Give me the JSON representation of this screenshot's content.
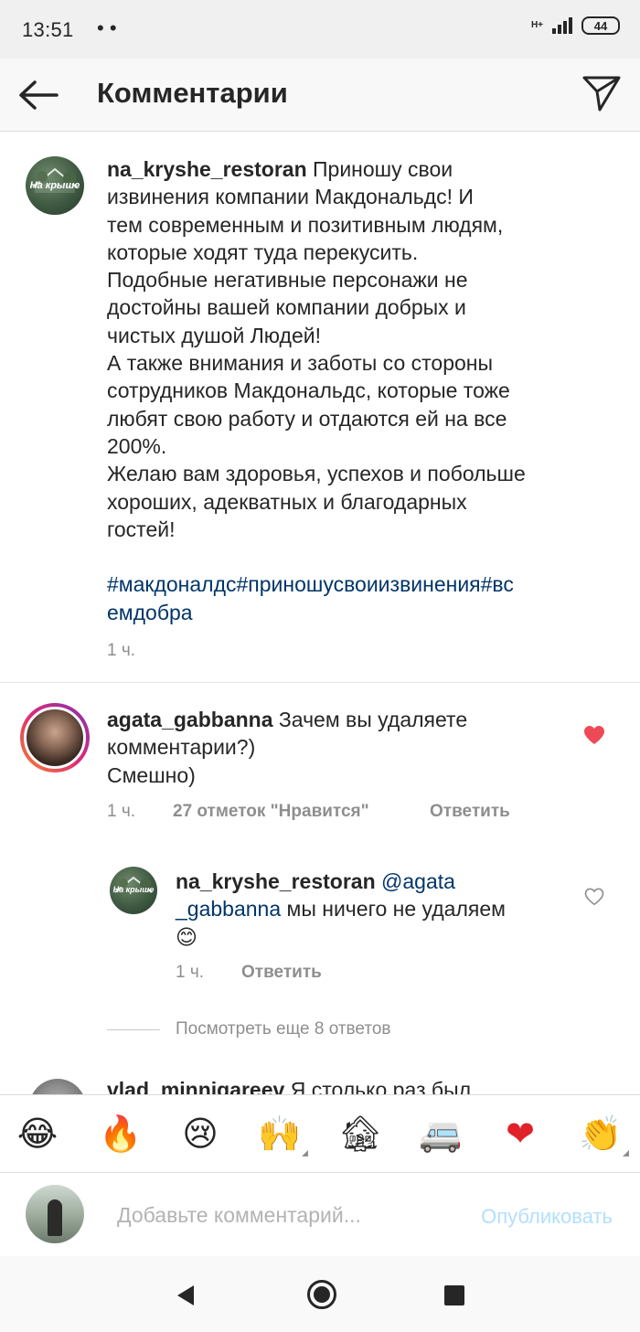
{
  "status": {
    "time": "13:51",
    "dots": "• •",
    "network": "H+",
    "battery": "44"
  },
  "header": {
    "title": "Комментарии"
  },
  "post": {
    "username": "na_kryshe_restoran",
    "text": " Приношу свои\nизвинения компании Макдональдс! И\nтем современным и позитивным людям,\nкоторые ходят туда перекусить.\nПодобные негативные персонажи не\nдостойны вашей компании добрых и\nчистых душой Людей!\nА также внимания и заботы со стороны\nсотрудников Макдональдс, которые тоже\nлюбят свою работу и отдаются ей на все\n200%.\nЖелаю вам здоровья, успехов и побольше\nхороших, адекватных и благодарных\nгостей!\n\n",
    "hashtags": "#макдоналдс#приношусвоиизвинения#вс\nемдобра",
    "time": "1 ч.",
    "avatar_text": "На крыше"
  },
  "comment1": {
    "username": "agata_gabbanna",
    "text": " Зачем вы удаляете\nкомментарии?)\nСмешно)",
    "time": "1 ч.",
    "likes": "27 отметок \"Нравится\"",
    "reply": "Ответить",
    "liked": true
  },
  "reply1": {
    "username": "na_kryshe_restoran",
    "mention_part1": " @agata\n",
    "mention_part2": "_gabbanna",
    "text": " мы ничего не удаляем\n😊",
    "time": "1 ч.",
    "reply": "Ответить"
  },
  "more_replies": "Посмотреть еще 8 ответов",
  "comment2": {
    "username": "vlad_minnigareev",
    "text": " Я столько раз был"
  },
  "emoji_bar": [
    {
      "name": "joy-emoji",
      "glyph": "😂"
    },
    {
      "name": "fire-emoji",
      "glyph": "🔥"
    },
    {
      "name": "crying-emoji",
      "glyph": "😢"
    },
    {
      "name": "raised-hands-emoji",
      "glyph": "🙌"
    },
    {
      "name": "hut-emoji",
      "glyph": "🏚"
    },
    {
      "name": "van-emoji",
      "glyph": "🚐"
    },
    {
      "name": "heart-emoji",
      "glyph": "❤"
    },
    {
      "name": "clap-emoji",
      "glyph": "👏"
    }
  ],
  "composer": {
    "placeholder": "Добавьте комментарий...",
    "post_label": "Опубликовать"
  },
  "colors": {
    "accent_link": "#003569",
    "like_red": "#ed4956",
    "post_disabled": "#b2dffc"
  }
}
